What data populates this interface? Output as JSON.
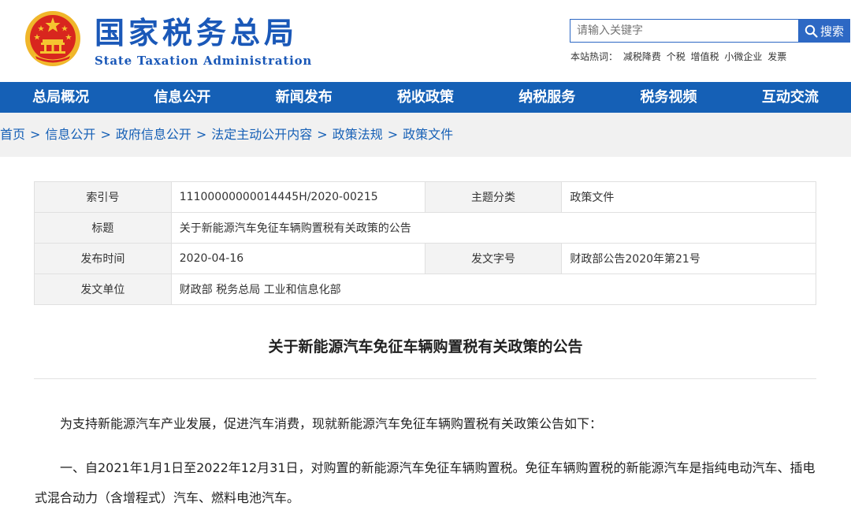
{
  "header": {
    "brand_cn": "国家税务总局",
    "brand_en": "State Taxation Administration",
    "search_placeholder": "请输入关键字",
    "search_button": "搜索",
    "hot_label": "本站热词：",
    "hot_words": [
      "减税降费",
      "个税",
      "增值税",
      "小微企业",
      "发票"
    ]
  },
  "nav": [
    "总局概况",
    "信息公开",
    "新闻发布",
    "税收政策",
    "纳税服务",
    "税务视频",
    "互动交流"
  ],
  "breadcrumb": [
    "首页",
    "信息公开",
    "政府信息公开",
    "法定主动公开内容",
    "政策法规",
    "政策文件"
  ],
  "meta": {
    "index_label": "索引号",
    "index_value": "11100000000014445H/2020-00215",
    "category_label": "主题分类",
    "category_value": "政策文件",
    "title_label": "标题",
    "title_value": "关于新能源汽车免征车辆购置税有关政策的公告",
    "date_label": "发布时间",
    "date_value": "2020-04-16",
    "docno_label": "发文字号",
    "docno_value": "财政部公告2020年第21号",
    "issuer_label": "发文单位",
    "issuer_value": "财政部 税务总局 工业和信息化部"
  },
  "article": {
    "title": "关于新能源汽车免征车辆购置税有关政策的公告",
    "p1": "为支持新能源汽车产业发展，促进汽车消费，现就新能源汽车免征车辆购置税有关政策公告如下：",
    "p2": "一、自2021年1月1日至2022年12月31日，对购置的新能源汽车免征车辆购置税。免征车辆购置税的新能源汽车是指纯电动汽车、插电式混合动力（含增程式）汽车、燃料电池汽车。"
  },
  "colors": {
    "brand": "#1a58b8",
    "nav_bg": "#1560b6",
    "emblem_red": "#d8261e",
    "emblem_gold": "#f5c530"
  },
  "icons": {
    "emblem": "national-emblem-icon",
    "search": "magnifier-icon"
  }
}
